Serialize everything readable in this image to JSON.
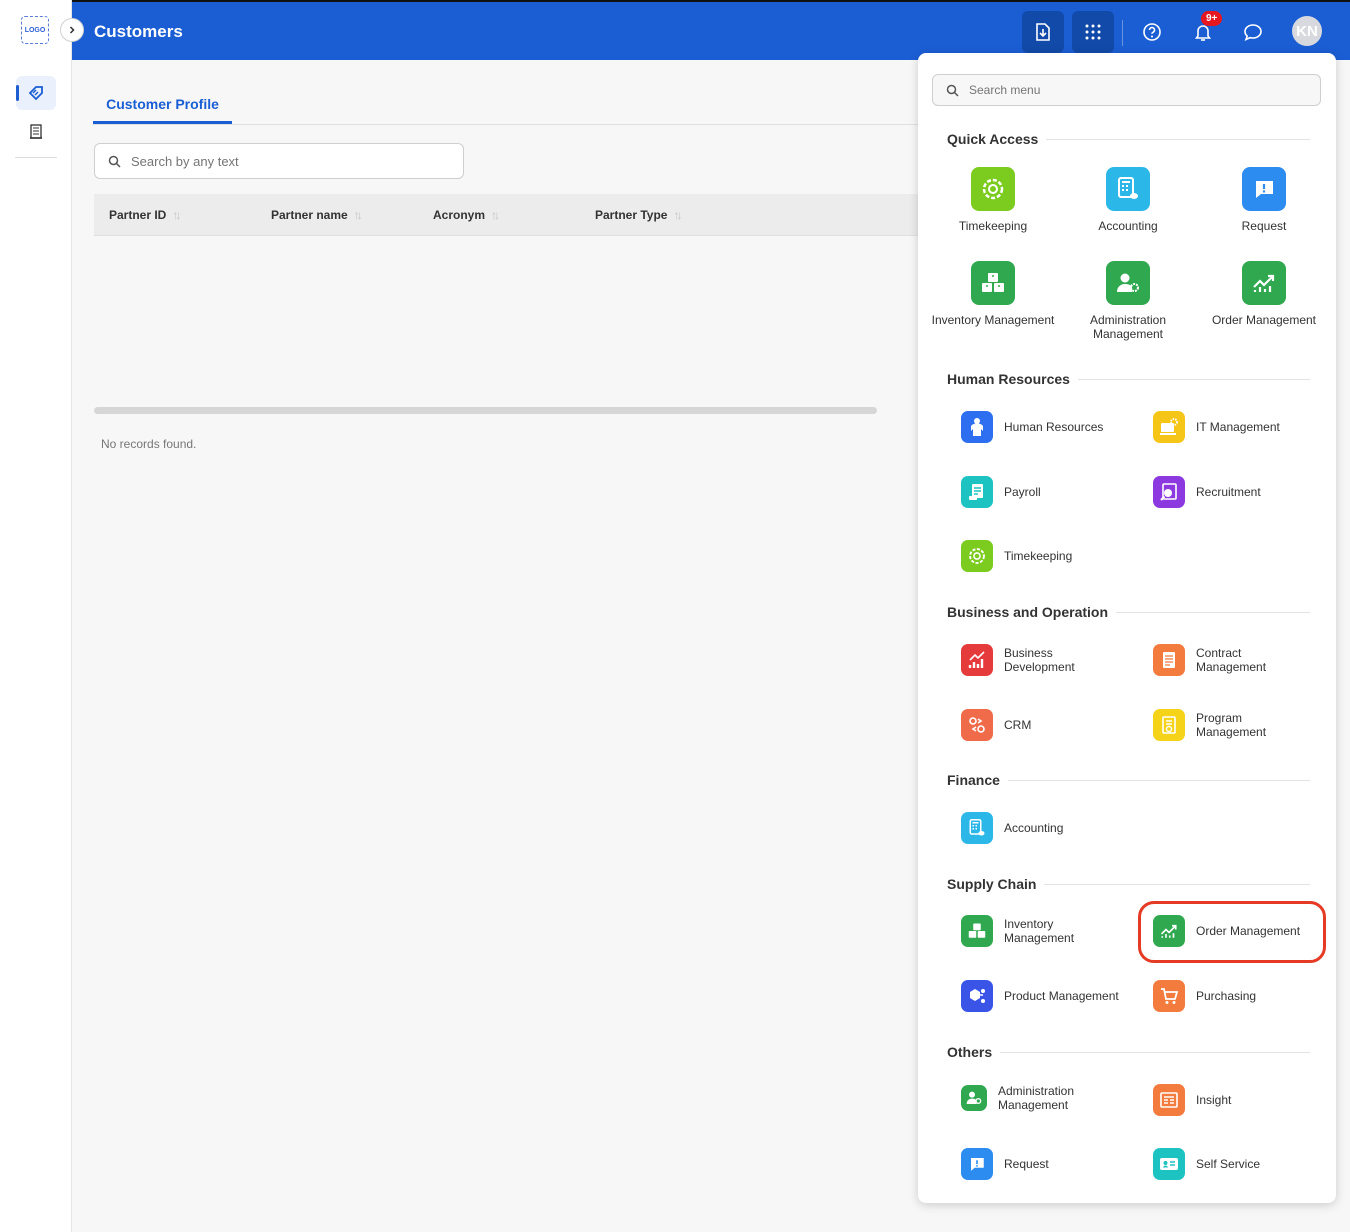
{
  "header": {
    "title": "Customers",
    "notification_count": "9+",
    "avatar_initials": "KN"
  },
  "rail": {
    "logo_text": "LOGO"
  },
  "main": {
    "tab": "Customer Profile",
    "search_placeholder": "Search by any text",
    "columns": [
      "Partner ID",
      "Partner name",
      "Acronym",
      "Partner Type"
    ],
    "empty_message": "No records found."
  },
  "menu": {
    "search_placeholder": "Search menu",
    "sections": {
      "quick_access": "Quick Access",
      "human_resources": "Human Resources",
      "business_operation": "Business and Operation",
      "finance": "Finance",
      "supply_chain": "Supply Chain",
      "others": "Others"
    },
    "quick_access": [
      "Timekeeping",
      "Accounting",
      "Request",
      "Inventory Management",
      "Administration Management",
      "Order Management"
    ],
    "human_resources": [
      "Human Resources",
      "IT Management",
      "Payroll",
      "Recruitment",
      "Timekeeping"
    ],
    "business_operation": [
      "Business Development",
      "Contract Management",
      "CRM",
      "Program Management"
    ],
    "finance": [
      "Accounting"
    ],
    "supply_chain": [
      "Inventory Management",
      "Order Management",
      "Product Management",
      "Purchasing"
    ],
    "others": [
      "Administration Management",
      "Insight",
      "Request",
      "Self Service"
    ]
  },
  "colors": {
    "primary": "#1b5ed4",
    "highlight": "#e53a24",
    "green": "#2fa84f",
    "lime": "#7ccc1f",
    "cyan": "#2bb7e8",
    "blue": "#2d8cf0",
    "orange": "#f47b3e",
    "yellow": "#f5c518",
    "red": "#e63b3b",
    "purple": "#8c3ae0",
    "teal": "#1cc3c0",
    "indigo": "#3b54e8"
  }
}
